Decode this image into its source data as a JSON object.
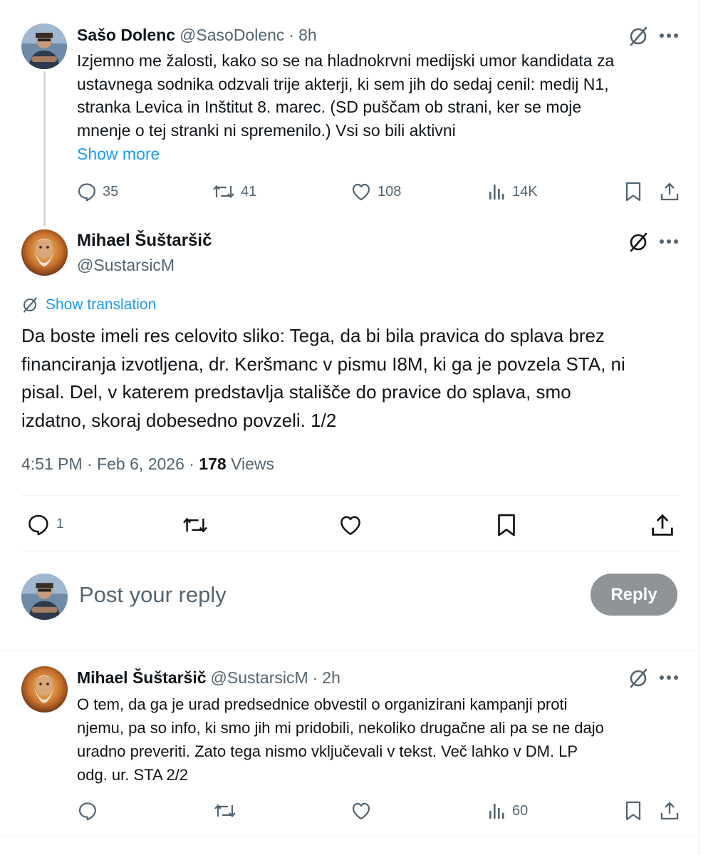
{
  "parent_tweet": {
    "author_name": "Sašo Dolenc",
    "author_handle": "@SasoDolenc",
    "separator": "·",
    "time": "8h",
    "lines": [
      "Izjemno me žalosti, kako so se na hladnokrvni medijski umor kandidata za",
      "ustavnega sodnika odzvali trije akterji, ki sem jih do sedaj cenil: medij N1,",
      "stranka Levica in Inštitut 8. marec. (SD puščam ob strani, ker se moje",
      "mnenje o tej stranki ni spremenilo.) Vsi so bili aktivni"
    ],
    "show_more": "Show more",
    "replies": "35",
    "reposts": "41",
    "likes": "108",
    "views": "14K"
  },
  "main_tweet": {
    "author_name": "Mihael Šuštaršič",
    "author_handle": "@SustarsicM",
    "show_translation": "Show translation",
    "lines": [
      "Da boste imeli res celovito sliko: Tega, da bi bila pravica do splava brez",
      "financiranja izvotljena, dr. Keršmanc v pismu I8M, ki ga je povzela STA, ni",
      "pisal. Del, v katerem predstavlja stališče do pravice do splava, smo",
      "izdatno, skoraj dobesedno povzeli. 1/2"
    ],
    "timestamp": "4:51 PM · Feb 6, 2026 ·",
    "views_count": "178",
    "views_label": "Views",
    "replies": "1"
  },
  "composer": {
    "placeholder": "Post your reply",
    "reply_label": "Reply"
  },
  "reply_tweet": {
    "author_name": "Mihael Šuštaršič",
    "author_handle": "@SustarsicM",
    "separator": "·",
    "time": "2h",
    "lines": [
      "O tem, da ga je urad predsednice obvestil o organizirani kampanji proti",
      "njemu, pa so info, ki smo jih mi pridobili, nekoliko drugačne ali pa se ne dajo",
      "uradno preveriti. Zato tega nismo vključevali v tekst. Več lahko v DM. LP",
      "odg. ur. STA 2/2"
    ],
    "views": "60"
  },
  "colors": {
    "text": "#0f1419",
    "secondary": "#536471",
    "link": "#1d9bf0",
    "reply_button_disabled": "#8f9498",
    "border": "#eff3f4"
  },
  "icons": [
    "grok-icon",
    "more-icon",
    "reply-icon",
    "repost-icon",
    "like-icon",
    "views-icon",
    "bookmark-icon",
    "share-icon",
    "translate-icon"
  ]
}
